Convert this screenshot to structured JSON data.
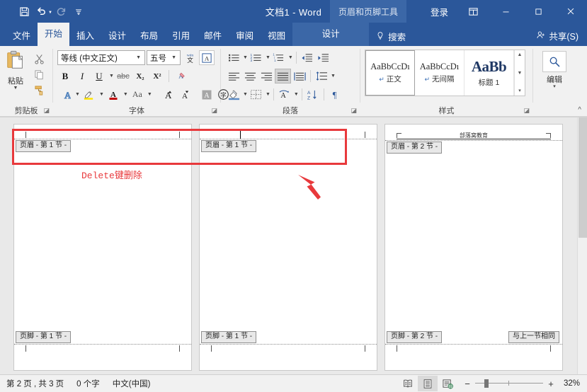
{
  "titlebar": {
    "quick_access": [
      {
        "name": "save-icon",
        "label": "保存"
      },
      {
        "name": "undo-icon",
        "label": "撤销"
      },
      {
        "name": "redo-icon",
        "label": "恢复"
      },
      {
        "name": "customize-qat-icon",
        "label": "自定义快速访问工具栏"
      }
    ],
    "document_title": "文档1 - Word",
    "contextual_tab": "页眉和页脚工具",
    "signin": "登录",
    "restore_label": "还原",
    "minimize_label": "—",
    "maximize_label": "□",
    "close_label": "✕"
  },
  "tabs": [
    {
      "label": "文件",
      "active": false
    },
    {
      "label": "开始",
      "active": true
    },
    {
      "label": "插入",
      "active": false
    },
    {
      "label": "设计",
      "active": false
    },
    {
      "label": "布局",
      "active": false
    },
    {
      "label": "引用",
      "active": false
    },
    {
      "label": "邮件",
      "active": false
    },
    {
      "label": "审阅",
      "active": false
    },
    {
      "label": "视图",
      "active": false
    }
  ],
  "contextual_tab_label": "设计",
  "tellme": "搜索",
  "share": "共享(S)",
  "ribbon": {
    "groups": [
      {
        "name": "clipboard",
        "label": "剪贴板"
      },
      {
        "name": "font",
        "label": "字体"
      },
      {
        "name": "paragraph",
        "label": "段落"
      },
      {
        "name": "styles",
        "label": "样式"
      },
      {
        "name": "editing",
        "label": "编辑"
      }
    ],
    "clipboard": {
      "paste_label": "粘贴",
      "cut_label": "剪切",
      "copy_label": "复制",
      "format_painter_label": "格式刷"
    },
    "font": {
      "font_name": "等线 (中文正文)",
      "font_size": "五号",
      "bold": "B",
      "italic": "I",
      "underline": "U",
      "strikethrough": "abc",
      "subscript": "X₂",
      "superscript": "X²",
      "clear_format_label": "清除所有格式",
      "phonetic_label": "拼音指南",
      "charborder_label": "字符边框",
      "textcolor_label": "字体颜色",
      "highlight_label": "以不同颜色突出显示文本",
      "texteffects_label": "文本效果和版式",
      "changecase_label": "Aa",
      "grow_font": "A",
      "shrink_font": "A",
      "char_shading_label": "字符底纹",
      "enclose_label": "带圈字符"
    },
    "paragraph": {
      "bullets_label": "项目符号",
      "numbering_label": "编号",
      "multilevel_label": "多级列表",
      "dec_indent_label": "减少缩进量",
      "inc_indent_label": "增加缩进量",
      "align_left_label": "左对齐",
      "align_center_label": "居中",
      "align_right_label": "右对齐",
      "justify_label": "两端对齐",
      "distribute_label": "分散对齐",
      "line_spacing_label": "行和段落间距",
      "shading_label": "底纹",
      "borders_label": "边框",
      "cn_layout_label": "中文版式",
      "sort_label": "排序",
      "show_marks_label": "显示/隐藏编辑标记"
    },
    "styles": {
      "items": [
        {
          "preview": "AaBbCcDı",
          "name": "正文",
          "selected": true
        },
        {
          "preview": "AaBbCcDı",
          "name": "无间隔",
          "selected": false
        },
        {
          "preview": "AaBb",
          "name": "标题 1",
          "selected": false
        }
      ],
      "scroll_up": "▲",
      "scroll_down": "▼",
      "more": "▾"
    },
    "editing": {
      "label": "编辑",
      "caret": "▾"
    },
    "collapse_label": "^"
  },
  "document": {
    "pages": [
      {
        "id": "page-1",
        "header_tag": "页眉 - 第 1 节 -",
        "footer_tag": "页脚 - 第 1 节 -",
        "header_text": "",
        "same_as_previous": ""
      },
      {
        "id": "page-2",
        "header_tag": "页眉 - 第 1 节 -",
        "footer_tag": "页脚 - 第 1 节 -",
        "header_text": "",
        "same_as_previous": ""
      },
      {
        "id": "page-3",
        "header_tag": "页眉 - 第 2 节 -",
        "footer_tag": "页脚 - 第 2 节 -",
        "header_text": "部落窝教育",
        "same_as_previous": "与上一节相同"
      }
    ],
    "annotation": {
      "delete_note_mono": "Delete",
      "delete_note_cn": "键删除",
      "highlight_color": "#e8393c",
      "arrow_color": "#e8393c"
    }
  },
  "statusbar": {
    "page_info": "第 2 页 , 共 3 页",
    "word_count": "0 个字",
    "language": "中文(中国)",
    "views": [
      {
        "name": "read-mode-icon",
        "label": "阅读视图",
        "active": false
      },
      {
        "name": "print-layout-icon",
        "label": "页面视图",
        "active": true
      },
      {
        "name": "web-layout-icon",
        "label": "Web 版式视图",
        "active": false
      }
    ],
    "zoom_out": "−",
    "zoom_in": "+",
    "zoom_level": "32%"
  }
}
